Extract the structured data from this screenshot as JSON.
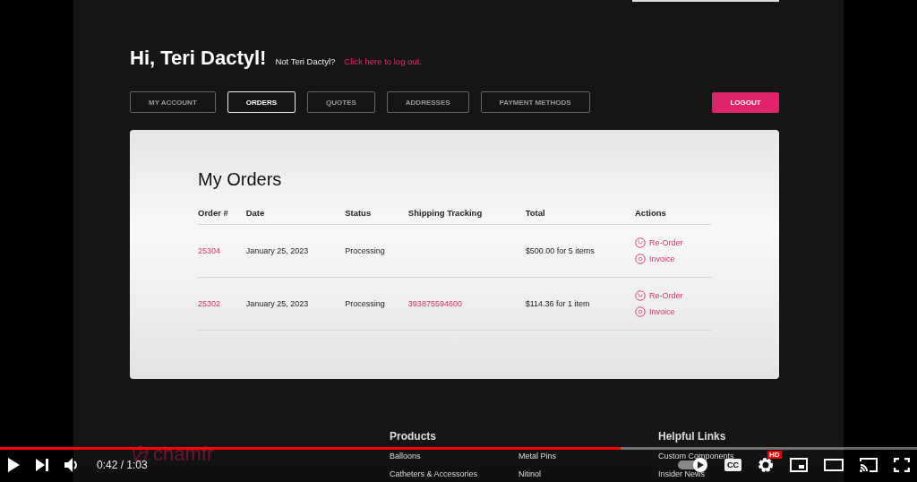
{
  "video": {
    "page": {
      "greeting": "Hi, Teri Dactyl!",
      "not_user": "Not Teri Dactyl?",
      "logout_link": "Click here to log out.",
      "tabs": [
        {
          "label": "MY ACCOUNT",
          "selected": false
        },
        {
          "label": "ORDERS",
          "selected": true
        },
        {
          "label": "QUOTES",
          "selected": false
        },
        {
          "label": "ADDRESSES",
          "selected": false
        },
        {
          "label": "PAYMENT METHODS",
          "selected": false
        }
      ],
      "logout_button": "LOGOUT",
      "orders": {
        "title": "My Orders",
        "columns": [
          "Order #",
          "Date",
          "Status",
          "Shipping Tracking",
          "Total",
          "Actions"
        ],
        "rows": [
          {
            "order": "25304",
            "date": "January 25, 2023",
            "status": "Processing",
            "total": "$500.00 for 5 items",
            "actions": [
              "Re-Order",
              "Invoice"
            ]
          },
          {
            "order": "25302",
            "date": "January 25, 2023",
            "status": "Processing",
            "tracking": "393875594600",
            "total": "$114.36 for 1 item",
            "actions": [
              "Re-Order",
              "Invoice"
            ]
          }
        ]
      },
      "footer": {
        "logo": "chamfr",
        "sections": [
          {
            "title": "Products",
            "link_columns": [
              [
                "Balloons",
                "Catheters & Accessories"
              ],
              [
                "Metal Pins",
                "Nitinol"
              ]
            ]
          },
          {
            "title": "Helpful Links",
            "link_columns": [
              [
                "Custom Components",
                "Insider News"
              ]
            ]
          }
        ]
      }
    }
  },
  "player": {
    "progress": {
      "level": 0.677
    },
    "time": "0:42 / 1:03",
    "cc_label": "CC",
    "hd_badge": "HD"
  }
}
